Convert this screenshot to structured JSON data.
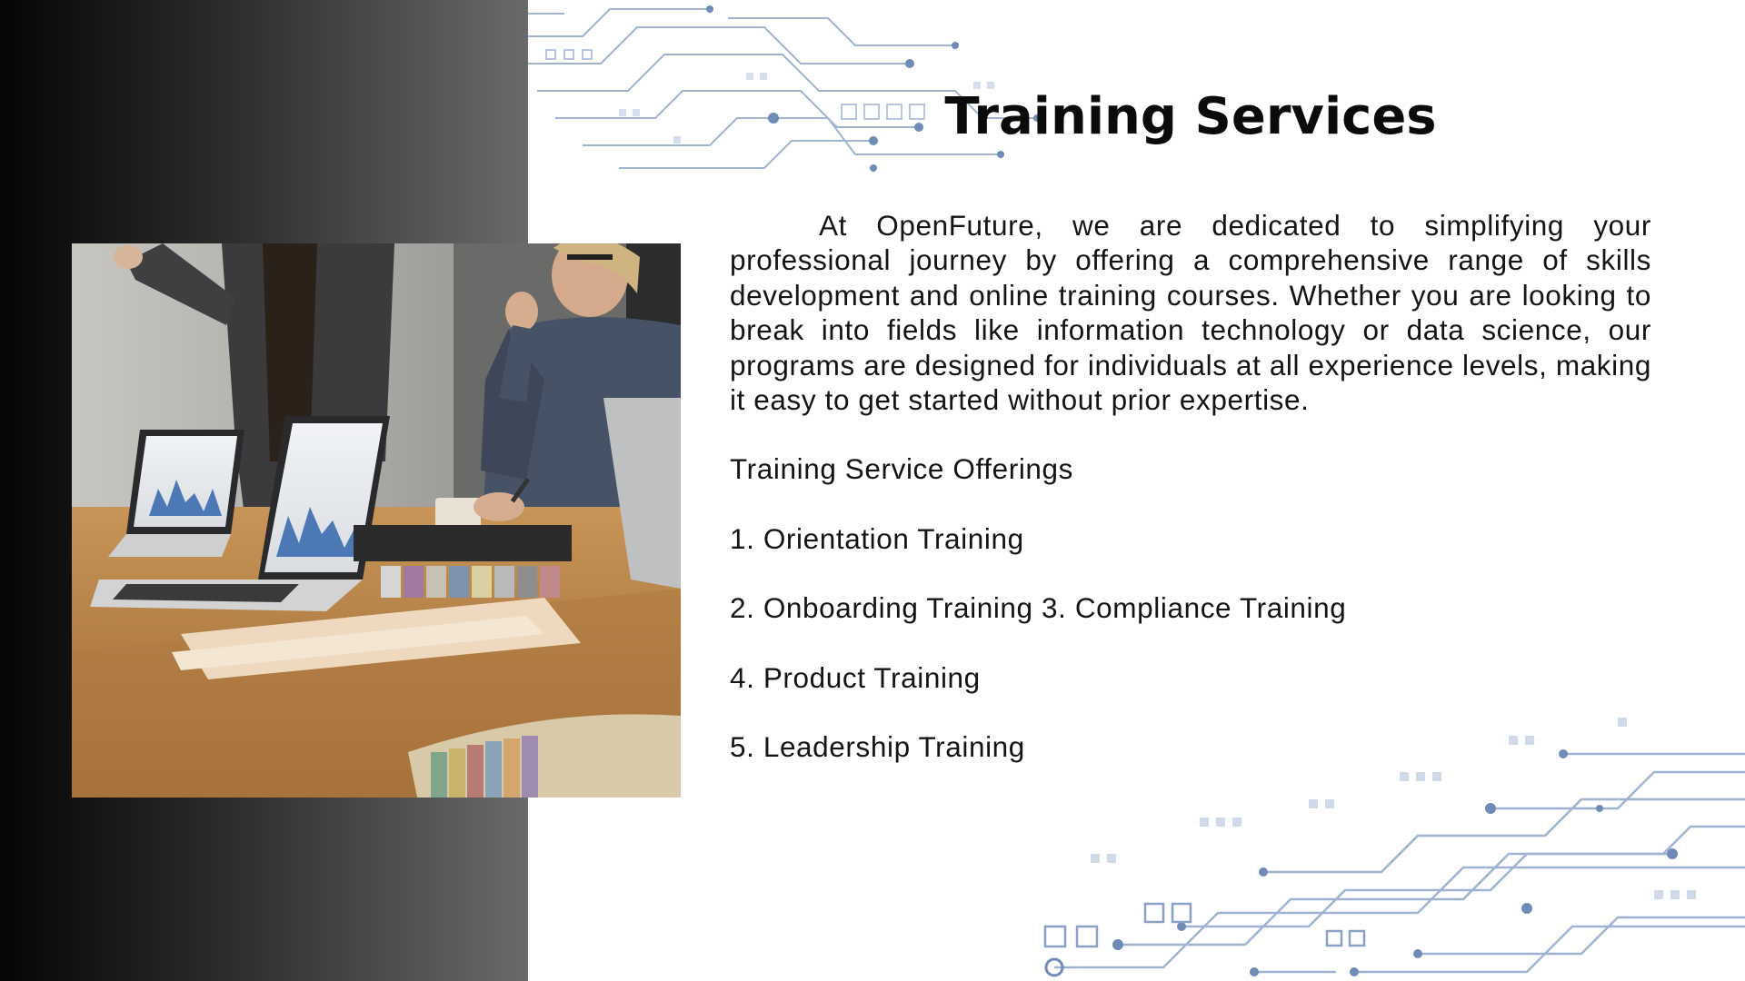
{
  "slide": {
    "title": "Training Services",
    "intro": "At OpenFuture, we are dedicated to simplifying your professional journey by offering a comprehensive range of skills development and online training courses. Whether you are looking to break into fields like information technology or data science, our programs are designed for individuals at all experience levels, making it easy to get started without prior expertise.",
    "offerings_heading": "Training Service Offerings",
    "offerings": [
      "1. Orientation Training",
      "2. Onboarding Training 3. Compliance Training",
      "4. Product Training",
      "5. Leadership Training"
    ]
  },
  "colors": {
    "circuit": "#5f7fae",
    "circuit_light": "#c3d0e3",
    "title": "#0b0b0b",
    "body_text": "#141414",
    "left_panel_dark": "#050505",
    "left_panel_light": "#6a6a6a"
  }
}
